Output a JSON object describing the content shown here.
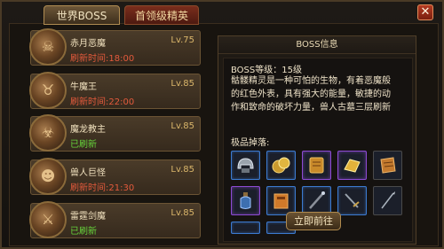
{
  "tabs": [
    {
      "label": "世界BOSS",
      "active": true
    },
    {
      "label": "首领级精英",
      "active": false
    }
  ],
  "close_label": "✕",
  "boss_list": [
    {
      "name": "赤月恶魔",
      "level": "Lv.75",
      "status": "刷新时间:18:00",
      "status_color": "red",
      "icon": "red-moon-demon-avatar"
    },
    {
      "name": "牛魔王",
      "level": "Lv.85",
      "status": "刷新时间:22:00",
      "status_color": "red",
      "icon": "bull-demon-king-avatar"
    },
    {
      "name": "魔龙教主",
      "level": "Lv.85",
      "status": "已刷新",
      "status_color": "green",
      "icon": "dragon-cult-leader-avatar"
    },
    {
      "name": "兽人巨怪",
      "level": "Lv.85",
      "status": "刷新时间:21:30",
      "status_color": "red",
      "icon": "orc-giant-avatar"
    },
    {
      "name": "雷霆剑魔",
      "level": "Lv.85",
      "status": "已刷新",
      "status_color": "green",
      "icon": "thunder-sword-demon-avatar"
    }
  ],
  "info": {
    "header": "BOSS信息",
    "boss_level": "BOSS等级：15级",
    "desc_lines": [
      "骷髅精灵是一种可怕的生物，有着恶魔般",
      "的红色外表，具有强大的能量，敏捷的动",
      "作和致命的破坏力量，兽人古墓三层刷新"
    ],
    "drops_title": "极品掉落:",
    "drops": [
      {
        "icon": "helmet-icon",
        "rarity": "blue"
      },
      {
        "icon": "gold-coins-icon",
        "rarity": "blue"
      },
      {
        "icon": "scroll-icon",
        "rarity": "purple"
      },
      {
        "icon": "gold-treasure-icon",
        "rarity": "purple"
      },
      {
        "icon": "map-scroll-icon",
        "rarity": "gray"
      },
      {
        "icon": "potion-bottle-icon",
        "rarity": "purple"
      },
      {
        "icon": "book-icon",
        "rarity": "blue"
      },
      {
        "icon": "staff-icon",
        "rarity": "blue"
      },
      {
        "icon": "sword-icon",
        "rarity": "blue"
      },
      {
        "icon": "spear-icon",
        "rarity": "gray"
      }
    ],
    "go_button": "立即前往"
  },
  "colors": {
    "red_time": "#e35a3c",
    "green_time": "#66d23b",
    "accent_gold": "#d9b56a"
  }
}
